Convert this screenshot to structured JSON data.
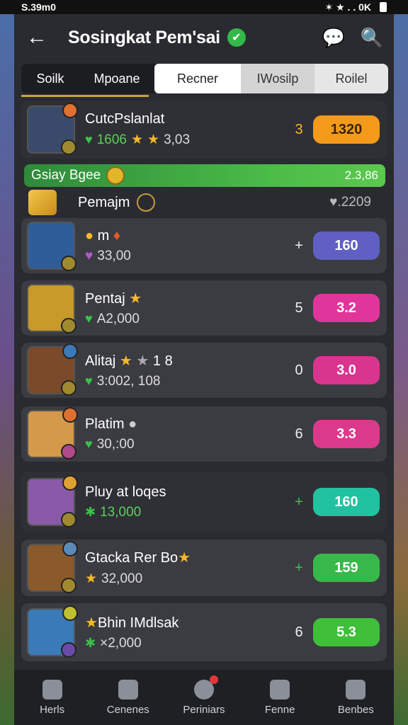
{
  "status": {
    "time": "S.39m0",
    "right": "✶ ★ . . 0K"
  },
  "header": {
    "title": "Sosingkat Pem'sai",
    "verified": "✔"
  },
  "tabs": [
    "Soilk",
    "Mpoane",
    "Recner",
    "IWosilp",
    "Roilel"
  ],
  "top_row": {
    "name": "CutcPslanlat",
    "stat": "1606",
    "stat2": "3,03",
    "rank": "3",
    "value": "1320"
  },
  "banner": {
    "title": "Gsiay Bgee",
    "value": "2.3,86"
  },
  "sub_header": {
    "name": "Pemajm",
    "value": "♥.2209"
  },
  "rows": [
    {
      "name": "m",
      "stat": "33,00",
      "rank": "+",
      "value": "160",
      "pill_color": "#5f5fc4",
      "avatar_color": "#2f5d9a"
    },
    {
      "name": "Pentaj",
      "stat": "A2,000",
      "rank": "5",
      "value": "3.2",
      "pill_color": "#e0359a",
      "avatar_color": "#c79a2a"
    },
    {
      "name": "Alitaj",
      "stat": "3:002, 108",
      "rank": "0",
      "value": "3.0",
      "pill_color": "#d9358f",
      "avatar_color": "#7a4a2a",
      "extra": "1 8"
    },
    {
      "name": "Platim",
      "stat": "30,:00",
      "rank": "6",
      "value": "3.3",
      "pill_color": "#db3a8a",
      "avatar_color": "#d49a4a"
    },
    {
      "name": "Pluy at loqes",
      "stat": "13,000",
      "rank": "+",
      "value": "160",
      "pill_color": "#21c2a0",
      "avatar_color": "#8a5aa8"
    },
    {
      "name": "Gtacka Rer Bo",
      "stat": "32,000",
      "rank": "+",
      "value": "159",
      "pill_color": "#38b84a",
      "avatar_color": "#8a5a2a"
    },
    {
      "name": "Bhin IMdlsak",
      "stat": "×2,000",
      "rank": "6",
      "value": "5.3",
      "pill_color": "#3fbf3a",
      "avatar_color": "#3a7ab8"
    }
  ],
  "nav": [
    {
      "label": "Herls"
    },
    {
      "label": "Cenenes"
    },
    {
      "label": "Periniars"
    },
    {
      "label": "Fenne"
    },
    {
      "label": "Benbes"
    }
  ]
}
